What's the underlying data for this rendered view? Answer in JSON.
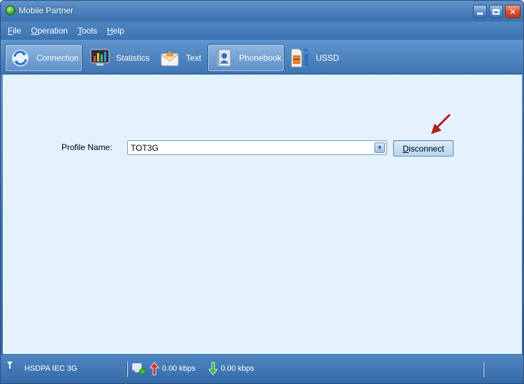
{
  "window": {
    "title": "Mobile Partner"
  },
  "menu": [
    {
      "accel": "F",
      "rest": "ile"
    },
    {
      "accel": "O",
      "rest": "peration"
    },
    {
      "accel": "T",
      "rest": "ools"
    },
    {
      "accel": "H",
      "rest": "elp"
    }
  ],
  "toolbar": {
    "connection": "Connection",
    "statistics": "Statistics",
    "text": "Text",
    "phonebook": "Phonebook",
    "ussd": "USSD"
  },
  "main": {
    "profile_label": "Profile Name:",
    "profile_value": "TOT3G",
    "disconnect_accel": "D",
    "disconnect_rest": "isconnect"
  },
  "status": {
    "network": "HSDPA  IEC 3G",
    "upload": "0.00 kbps",
    "download": "0.00 kbps"
  },
  "colors": {
    "accent_arrow": "#b01e1e",
    "background": "#e4f2fd"
  }
}
